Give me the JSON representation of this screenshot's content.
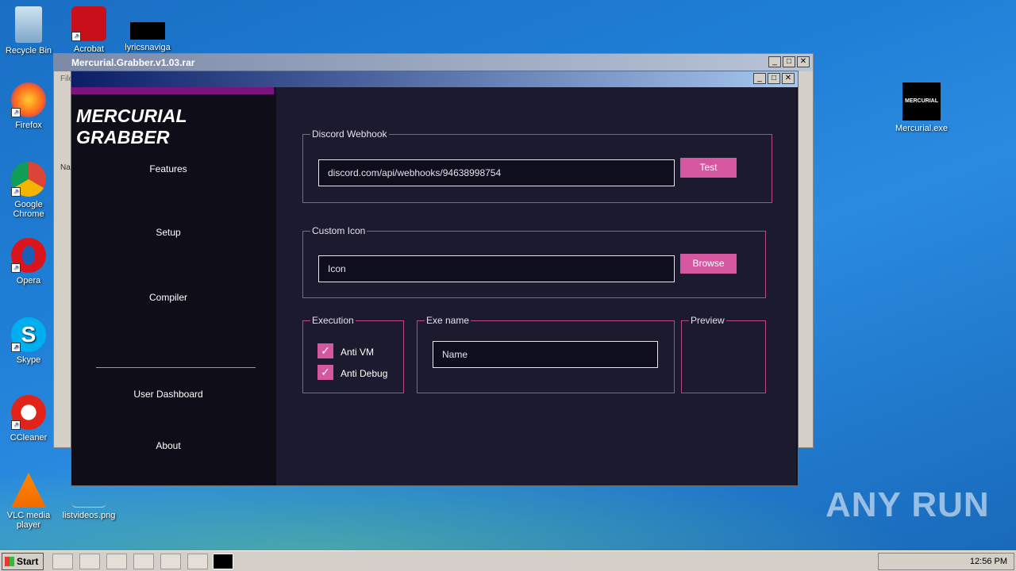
{
  "desktop": {
    "icons": [
      {
        "label": "Recycle Bin"
      },
      {
        "label": "Acrobat"
      },
      {
        "label": "lyricsnaviga"
      },
      {
        "label": "Firefox"
      },
      {
        "label": "Google Chrome"
      },
      {
        "label": "Opera"
      },
      {
        "label": "Skype"
      },
      {
        "label": "CCleaner"
      },
      {
        "label": "VLC media player"
      },
      {
        "label": "listvideos.png"
      },
      {
        "label": "Mercurial.exe",
        "badge": "MERCURIAL"
      }
    ],
    "watermark": "ANY RUN"
  },
  "winrar": {
    "title": "Mercurial.Grabber.v1.03.rar",
    "menu_hint": "File",
    "column_hint": "Na"
  },
  "app": {
    "logo": "MERCURIAL GRABBER",
    "nav": {
      "features": "Features",
      "setup": "Setup",
      "compiler": "Compiler",
      "dashboard": "User Dashboard",
      "about": "About"
    },
    "webhook": {
      "legend": "Discord Webhook",
      "value": "discord.com/api/webhooks/94638998754",
      "test_label": "Test"
    },
    "icon": {
      "legend": "Custom Icon",
      "value": "Icon",
      "browse_label": "Browse"
    },
    "execution": {
      "legend": "Execution",
      "anti_vm": "Anti VM",
      "anti_debug": "Anti Debug",
      "anti_vm_checked": true,
      "anti_debug_checked": true
    },
    "exe_name": {
      "legend": "Exe name",
      "value": "Name"
    },
    "preview": {
      "legend": "Preview"
    }
  },
  "taskbar": {
    "start_label": "Start",
    "clock": "12:56 PM"
  },
  "colors": {
    "accent": "#d457a0",
    "border": "#b6498a",
    "sidebar_bar": "#7a147e",
    "content_bg": "#1c1a2e"
  }
}
